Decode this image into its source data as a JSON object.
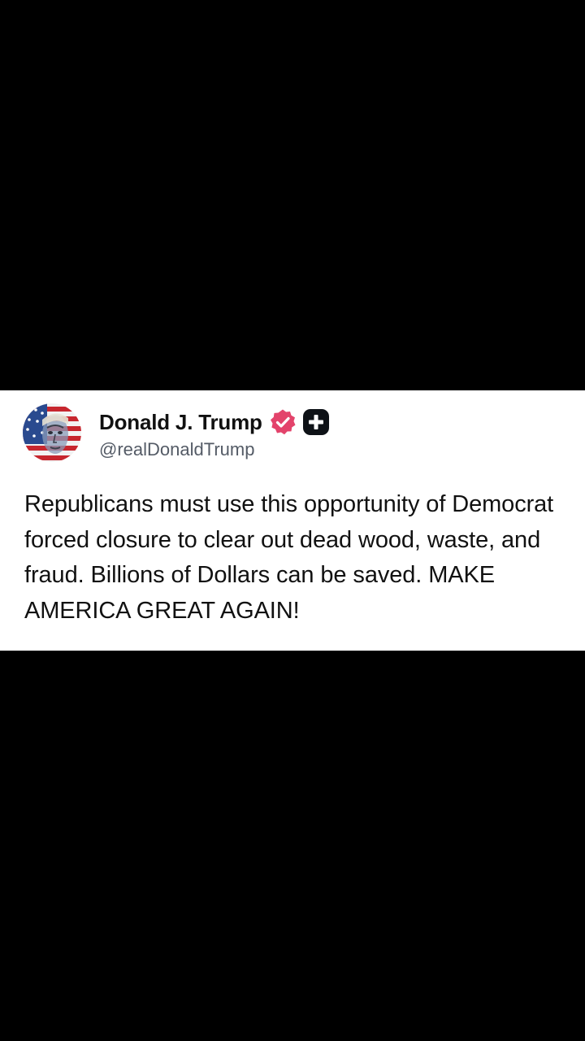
{
  "post": {
    "author": {
      "display_name": "Donald J. Trump",
      "handle": "@realDonaldTrump",
      "avatar_icon": "american-flag-portrait-avatar",
      "verified_icon": "verified-badge-icon",
      "plus_icon": "plus-badge-icon"
    },
    "text": "Republicans must use this opportunity of Democrat forced closure to clear out dead wood, waste, and fraud. Billions of Dollars can be saved. MAKE AMERICA GREAT AGAIN!"
  },
  "colors": {
    "background": "#000000",
    "card": "#ffffff",
    "text": "#111111",
    "handle": "#545b66",
    "verified": "#e3436b",
    "plus_badge": "#0e1217"
  }
}
